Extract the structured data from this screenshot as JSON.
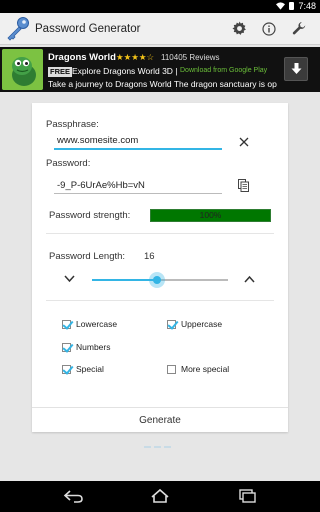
{
  "statusbar": {
    "time": "7:48"
  },
  "actionbar": {
    "title": "Password Generator",
    "icons": [
      "key-icon",
      "gear-icon",
      "info-icon",
      "wrench-icon"
    ]
  },
  "ad": {
    "title": "Dragons World",
    "stars": "★★★★☆",
    "reviews": "110405 Reviews",
    "free_badge": "FREE",
    "subtitle": "Explore Dragons World 3D |",
    "store": "Download from Google Play",
    "description": "Take a journey to Dragons World The dragon sanctuary is op"
  },
  "form": {
    "passphrase_label": "Passphrase:",
    "passphrase_value": "www.somesite.com",
    "password_label": "Password:",
    "password_value": "-9_P-6UrAe%Hb=vN",
    "strength_label": "Password strength:",
    "strength_value": "100%",
    "strength_fraction": 1.0,
    "length_label": "Password Length:",
    "length_value": "16",
    "length_slider_fraction": 0.48
  },
  "options": {
    "lowercase": {
      "label": "Lowercase",
      "checked": true
    },
    "uppercase": {
      "label": "Uppercase",
      "checked": true
    },
    "numbers": {
      "label": "Numbers",
      "checked": true
    },
    "special": {
      "label": "Special",
      "checked": true
    },
    "more_special": {
      "label": "More special",
      "checked": false
    }
  },
  "generate_label": "Generate",
  "colors": {
    "accent": "#33b5e5",
    "strength": "#007700"
  }
}
